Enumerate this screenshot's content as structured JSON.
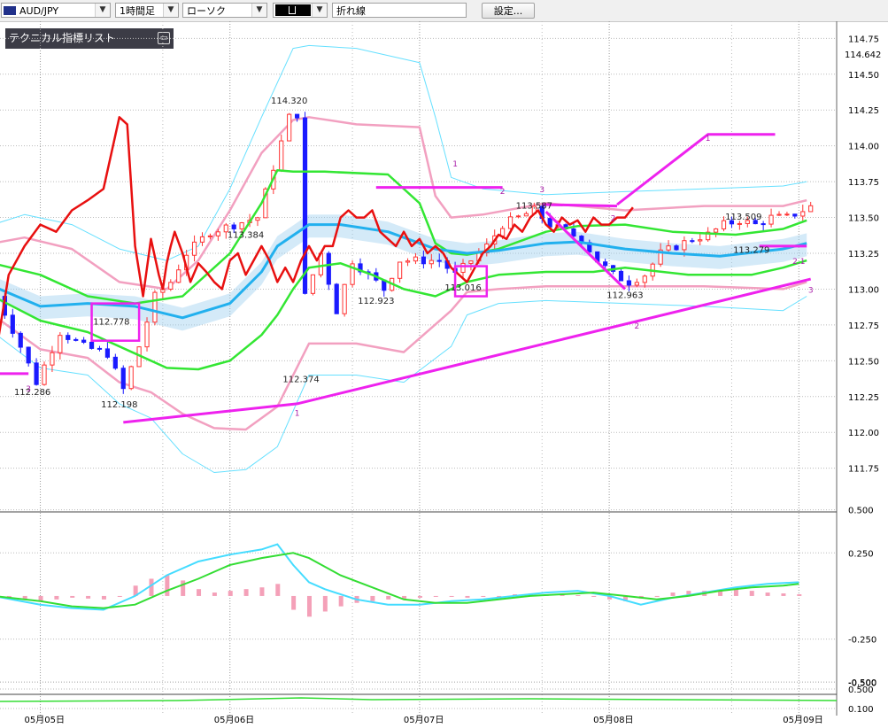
{
  "toolbar": {
    "symbol": "AUD/JPY",
    "timeframe": "1時間足",
    "chart_style": "ローソク",
    "line_type": "折れ線",
    "settings_label": "設定...",
    "dropdown_glyph": "▼"
  },
  "indicator_panel": {
    "title": "テクニカル指標リスト",
    "toggle_glyph": "▭"
  },
  "colors": {
    "up_candle": "#ff3333",
    "down_candle": "#1a1aff",
    "bb_outer": "#66e0ff",
    "bb_inner": "#f2a0c0",
    "ma_green": "#33e633",
    "ma_blue": "#22b0ee",
    "rsi_red": "#e81010",
    "trend_magenta": "#ee22ee",
    "cloud": "#9fd0f0"
  },
  "chart_data": [
    {
      "type": "candlestick",
      "symbol": "AUD/JPY",
      "timeframe": "1時間足",
      "y_ticks": [
        "114.75",
        "114.50",
        "114.25",
        "114.00",
        "113.75",
        "113.50",
        "113.25",
        "113.00",
        "112.75",
        "112.50",
        "112.25",
        "112.00",
        "111.75"
      ],
      "y_tick_values": [
        114.75,
        114.5,
        114.25,
        114.0,
        113.75,
        113.5,
        113.25,
        113.0,
        112.75,
        112.5,
        112.25,
        112.0,
        111.75
      ],
      "current_price_label": "114.642",
      "current_price": 114.642,
      "x_labels": [
        "05月05日",
        "05月06日",
        "05月07日",
        "05月08日",
        "05月09日"
      ],
      "x_label_hours": [
        6,
        30,
        54,
        78,
        102
      ],
      "ylim": [
        111.68,
        114.82
      ],
      "hours": 106,
      "annotations": [
        {
          "text": "114.320",
          "value": 114.32,
          "hour": 37.5
        },
        {
          "text": "113.384",
          "value": 113.384,
          "hour": 32
        },
        {
          "text": "112.923",
          "value": 112.923,
          "hour": 48.5
        },
        {
          "text": "113.016",
          "value": 113.016,
          "hour": 59.5
        },
        {
          "text": "113.587",
          "value": 113.587,
          "hour": 68.5
        },
        {
          "text": "112.963",
          "value": 112.963,
          "hour": 80
        },
        {
          "text": "113.509",
          "value": 113.509,
          "hour": 95
        },
        {
          "text": "113.279",
          "value": 113.279,
          "hour": 96
        },
        {
          "text": "112.778",
          "value": 112.778,
          "hour": 15
        },
        {
          "text": "112.286",
          "value": 112.286,
          "hour": 5
        },
        {
          "text": "112.198",
          "value": 112.198,
          "hour": 16
        },
        {
          "text": "112.374",
          "value": 112.374,
          "hour": 39
        }
      ],
      "wave_labels": [
        {
          "text": "1",
          "value": 114.06,
          "hour": 90.5
        },
        {
          "text": "2",
          "value": 113.5,
          "hour": 78.5
        },
        {
          "text": "1",
          "value": 113.88,
          "hour": 58.5
        },
        {
          "text": "2",
          "value": 113.69,
          "hour": 64.5
        },
        {
          "text": "3",
          "value": 113.7,
          "hour": 69.5
        },
        {
          "text": "2",
          "value": 112.75,
          "hour": 81.5
        },
        {
          "text": "2.1",
          "value": 113.2,
          "hour": 102
        },
        {
          "text": "3",
          "value": 113.0,
          "hour": 103.5
        },
        {
          "text": "3",
          "value": 112.31,
          "hour": 4.5
        },
        {
          "text": "1",
          "value": 112.14,
          "hour": 38.5
        }
      ],
      "trend_lines": [
        {
          "points": [
            [
              16.5,
              112.07
            ],
            [
              38.5,
              112.2
            ],
            [
              103.5,
              113.07
            ]
          ]
        },
        {
          "points": [
            [
              79,
              113.59
            ],
            [
              90.5,
              114.08
            ],
            [
              99,
              114.08
            ]
          ]
        },
        {
          "points": [
            [
              69.5,
              113.59
            ],
            [
              79,
              113.58
            ]
          ]
        },
        {
          "points": [
            [
              48.5,
              113.71
            ],
            [
              64.5,
              113.71
            ]
          ]
        },
        {
          "points": [
            [
              70,
              113.54
            ],
            [
              80,
              113.0
            ]
          ]
        },
        {
          "points": [
            [
              97,
              113.3
            ],
            [
              103,
              113.3
            ]
          ]
        },
        {
          "points": [
            [
              0,
              112.41
            ],
            [
              4.5,
              112.41
            ]
          ]
        }
      ],
      "boxes": [
        {
          "hours": [
            12.5,
            18.5
          ],
          "values": [
            112.64,
            112.9
          ]
        },
        {
          "hours": [
            58.5,
            62.5
          ],
          "values": [
            112.95,
            113.16
          ]
        }
      ],
      "series": [
        {
          "name": "bb_upper_outer",
          "x": [
            0,
            4,
            10,
            16,
            22,
            26,
            30,
            34,
            38,
            40,
            46,
            54,
            56,
            58,
            62,
            70,
            80,
            90,
            100,
            103
          ],
          "y": [
            113.45,
            113.52,
            113.45,
            113.28,
            113.2,
            113.3,
            113.7,
            114.2,
            114.68,
            114.7,
            114.68,
            114.58,
            114.2,
            113.78,
            113.7,
            113.66,
            113.68,
            113.7,
            113.72,
            113.75
          ]
        },
        {
          "name": "bb_lower_outer",
          "x": [
            0,
            6,
            12,
            16,
            20,
            24,
            28,
            32,
            36,
            40,
            46,
            52,
            58,
            60,
            64,
            70,
            80,
            90,
            100,
            103
          ],
          "y": [
            112.7,
            112.45,
            112.4,
            112.2,
            112.1,
            111.85,
            111.72,
            111.74,
            111.9,
            112.4,
            112.4,
            112.35,
            112.6,
            112.82,
            112.9,
            112.92,
            112.9,
            112.88,
            112.85,
            112.95
          ]
        },
        {
          "name": "bb_upper_inner",
          "x": [
            0,
            4,
            10,
            16,
            22,
            26,
            30,
            34,
            38,
            40,
            46,
            54,
            56,
            58,
            62,
            70,
            80,
            90,
            100,
            103
          ],
          "y": [
            113.32,
            113.36,
            113.28,
            113.05,
            113.0,
            113.2,
            113.55,
            113.95,
            114.18,
            114.2,
            114.15,
            114.13,
            113.65,
            113.5,
            113.52,
            113.6,
            113.55,
            113.58,
            113.58,
            113.62
          ]
        },
        {
          "name": "bb_lower_inner",
          "x": [
            0,
            6,
            12,
            16,
            20,
            24,
            28,
            32,
            36,
            40,
            46,
            52,
            58,
            60,
            64,
            70,
            80,
            90,
            100,
            103
          ],
          "y": [
            112.82,
            112.58,
            112.52,
            112.35,
            112.28,
            112.13,
            112.03,
            112.02,
            112.18,
            112.62,
            112.62,
            112.56,
            112.85,
            112.98,
            113.0,
            113.02,
            113.02,
            113.02,
            113.0,
            113.05
          ]
        },
        {
          "name": "ma_green_mid",
          "x": [
            0,
            6,
            12,
            18,
            24,
            30,
            34,
            36,
            38,
            42,
            50,
            54,
            56,
            58,
            60,
            64,
            70,
            74,
            80,
            86,
            94,
            100,
            103
          ],
          "y": [
            113.18,
            113.1,
            112.95,
            112.9,
            112.95,
            113.25,
            113.6,
            113.83,
            113.82,
            113.82,
            113.8,
            113.6,
            113.32,
            113.25,
            113.24,
            113.28,
            113.4,
            113.44,
            113.45,
            113.4,
            113.38,
            113.42,
            113.48
          ]
        },
        {
          "name": "ma_green_low",
          "x": [
            0,
            6,
            12,
            18,
            22,
            26,
            30,
            34,
            36,
            38,
            40,
            44,
            48,
            52,
            56,
            60,
            64,
            70,
            76,
            80,
            88,
            96,
            100,
            103
          ],
          "y": [
            112.95,
            112.78,
            112.7,
            112.55,
            112.45,
            112.44,
            112.5,
            112.68,
            112.82,
            113.0,
            113.15,
            113.18,
            113.1,
            113.0,
            112.95,
            113.05,
            113.1,
            113.12,
            113.12,
            113.15,
            113.1,
            113.1,
            113.15,
            113.2
          ]
        },
        {
          "name": "ma_blue",
          "x": [
            0,
            6,
            12,
            18,
            24,
            30,
            34,
            36,
            40,
            44,
            50,
            56,
            60,
            64,
            70,
            74,
            80,
            86,
            92,
            100,
            103
          ],
          "y": [
            113.02,
            112.88,
            112.9,
            112.88,
            112.8,
            112.9,
            113.12,
            113.3,
            113.45,
            113.45,
            113.4,
            113.28,
            113.25,
            113.27,
            113.32,
            113.33,
            113.28,
            113.25,
            113.23,
            113.28,
            113.32
          ]
        },
        {
          "name": "rsi_red",
          "x": [
            0,
            2,
            4,
            6,
            8,
            10,
            12,
            14,
            16,
            17,
            18,
            19,
            20,
            21,
            21.5,
            22,
            22.5,
            23,
            24,
            25,
            26,
            27,
            28,
            29,
            30,
            31,
            32,
            33,
            34,
            35,
            36,
            37,
            38,
            39,
            40,
            41,
            42,
            43,
            44,
            45,
            46,
            47,
            48,
            49,
            50,
            51,
            52,
            53,
            54,
            55,
            56,
            57,
            58,
            59,
            60,
            61,
            62,
            63,
            64,
            65,
            66,
            67,
            68,
            69,
            70,
            71,
            72,
            73,
            74,
            75,
            76,
            77,
            78,
            79,
            80,
            81
          ],
          "y": [
            112.42,
            113.1,
            113.3,
            113.45,
            113.4,
            113.55,
            113.62,
            113.7,
            114.2,
            114.15,
            113.3,
            112.95,
            113.35,
            113.1,
            113.0,
            113.18,
            113.3,
            113.4,
            113.25,
            113.05,
            113.18,
            113.12,
            113.05,
            113.0,
            113.2,
            113.25,
            113.1,
            113.2,
            113.3,
            113.2,
            113.05,
            113.15,
            113.05,
            113.2,
            113.3,
            113.2,
            113.3,
            113.3,
            113.5,
            113.55,
            113.5,
            113.5,
            113.55,
            113.4,
            113.35,
            113.3,
            113.4,
            113.3,
            113.35,
            113.25,
            113.3,
            113.25,
            113.15,
            113.1,
            113.05,
            113.15,
            113.25,
            113.3,
            113.38,
            113.35,
            113.45,
            113.4,
            113.5,
            113.55,
            113.45,
            113.4,
            113.5,
            113.45,
            113.48,
            113.4,
            113.5,
            113.45,
            113.45,
            113.5,
            113.5,
            113.57
          ]
        }
      ]
    },
    {
      "type": "macd",
      "y_ticks": [
        "0.500",
        "0.250",
        "-0.250",
        "-0.500"
      ],
      "y_tick_values": [
        0.5,
        0.25,
        -0.25,
        -0.5
      ],
      "ylim": [
        -0.56,
        0.58
      ],
      "series": [
        {
          "name": "macd_line",
          "x": [
            0,
            6,
            10,
            14,
            18,
            22,
            26,
            30,
            34,
            36,
            38,
            40,
            42,
            46,
            50,
            54,
            58,
            62,
            66,
            70,
            74,
            78,
            82,
            86,
            90,
            94,
            98,
            102
          ],
          "y": [
            0.0,
            -0.05,
            -0.07,
            -0.08,
            0.0,
            0.12,
            0.2,
            0.24,
            0.27,
            0.3,
            0.18,
            0.08,
            0.04,
            -0.02,
            -0.05,
            -0.05,
            -0.03,
            -0.02,
            0.0,
            0.02,
            0.03,
            0.0,
            -0.05,
            -0.01,
            0.02,
            0.05,
            0.07,
            0.08
          ]
        },
        {
          "name": "signal_line",
          "x": [
            0,
            6,
            10,
            14,
            18,
            22,
            26,
            30,
            34,
            38,
            40,
            44,
            48,
            52,
            56,
            60,
            64,
            68,
            72,
            76,
            80,
            84,
            88,
            92,
            96,
            100,
            102
          ],
          "y": [
            0.0,
            -0.03,
            -0.06,
            -0.07,
            -0.05,
            0.03,
            0.1,
            0.18,
            0.22,
            0.25,
            0.22,
            0.12,
            0.05,
            -0.02,
            -0.04,
            -0.04,
            -0.02,
            0.0,
            0.01,
            0.02,
            0.0,
            -0.02,
            0.0,
            0.03,
            0.05,
            0.06,
            0.07
          ]
        },
        {
          "name": "histogram",
          "x": [
            0,
            2,
            4,
            6,
            8,
            10,
            12,
            14,
            16,
            18,
            20,
            22,
            24,
            26,
            28,
            30,
            32,
            34,
            36,
            38,
            40,
            42,
            44,
            46,
            48,
            50,
            52,
            54,
            56,
            58,
            60,
            62,
            64,
            66,
            68,
            70,
            72,
            74,
            76,
            78,
            80,
            82,
            84,
            86,
            88,
            90,
            92,
            94,
            96,
            98,
            100,
            102
          ],
          "y": [
            0.0,
            -0.01,
            -0.02,
            -0.03,
            -0.02,
            -0.01,
            -0.015,
            -0.02,
            0.0,
            0.06,
            0.1,
            0.12,
            0.09,
            0.04,
            0.02,
            0.03,
            0.04,
            0.05,
            0.07,
            -0.08,
            -0.12,
            -0.09,
            -0.06,
            -0.04,
            -0.03,
            -0.02,
            -0.015,
            -0.01,
            0.0,
            0.0,
            -0.01,
            -0.005,
            0.0,
            0.01,
            0.015,
            0.01,
            0.01,
            0.005,
            0.0,
            -0.02,
            -0.03,
            -0.015,
            0.0,
            0.02,
            0.03,
            0.03,
            0.035,
            0.04,
            0.03,
            0.02,
            0.015,
            0.01
          ]
        }
      ]
    },
    {
      "type": "line",
      "y_ticks": [
        "-0.500",
        "0.500",
        "0.100"
      ],
      "y_tick_values": [
        -0.5,
        0.5,
        0.1
      ]
    }
  ]
}
